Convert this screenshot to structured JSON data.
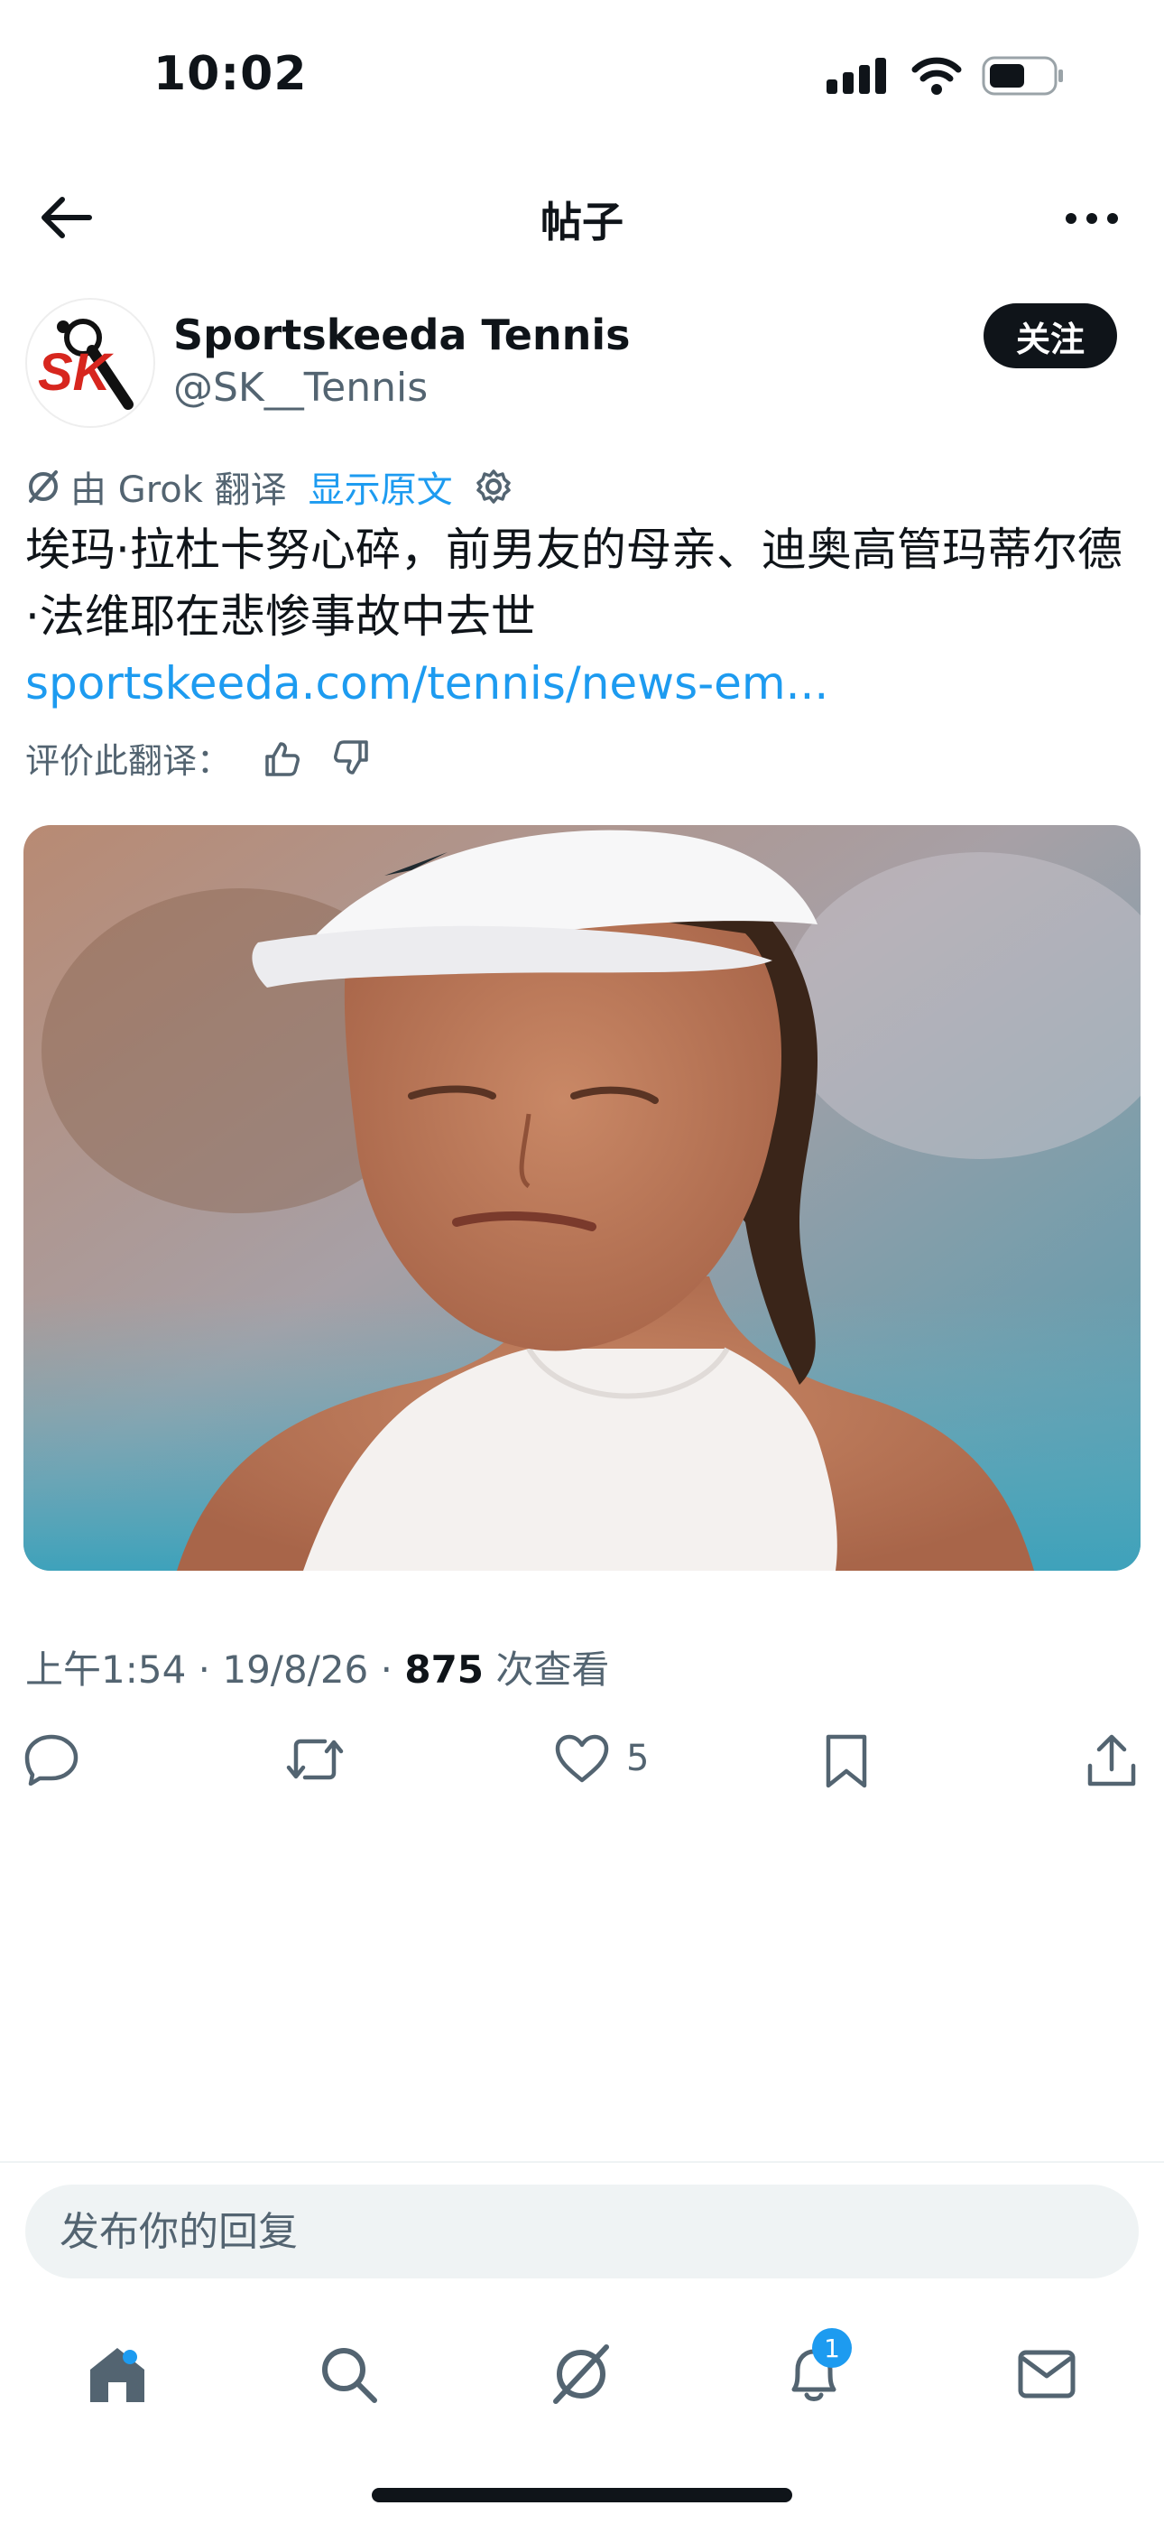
{
  "status_bar": {
    "time": "10:02"
  },
  "header": {
    "title": "帖子"
  },
  "author": {
    "name": "Sportskeeda Tennis",
    "handle": "@SK__Tennis",
    "avatar_text": "SK"
  },
  "follow_label": "关注",
  "translation": {
    "by_label": "由 Grok 翻译",
    "show_original_label": "显示原文"
  },
  "post": {
    "text": "埃玛·拉杜卡努心碎，前男友的母亲、迪奥高管玛蒂尔德·法维耶在悲惨事故中去世 ",
    "link_text": "sportskeeda.com/tennis/news-em..."
  },
  "rate_translation_label": "评价此翻译：",
  "media": {
    "description": "photo"
  },
  "meta": {
    "time_date": "上午1:54 · 19/8/26 · ",
    "views_count": "875",
    "views_label": " 次查看"
  },
  "actions": {
    "likes": "5"
  },
  "reply": {
    "placeholder": "发布你的回复"
  },
  "bottom_nav": {
    "notifications_badge": "1"
  },
  "colors": {
    "accent": "#1d9bf0",
    "text": "#0f1419",
    "muted": "#536471"
  }
}
